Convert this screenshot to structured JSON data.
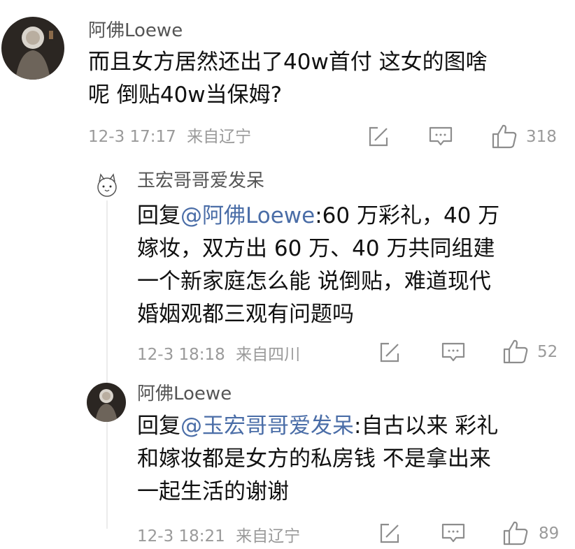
{
  "comments": [
    {
      "author": "阿佛Loewe",
      "text_lines": [
        "而且女方居然还出了40w首付 这女的图啥",
        "呢 倒贴40w当保姆?"
      ],
      "timestamp": "12-3 17:17",
      "location": "来自辽宁",
      "likes": "318"
    },
    {
      "author": "玉宏哥哥爱发呆",
      "reply_prefix": "回复",
      "reply_to": "@阿佛Loewe",
      "text_first": ":60 万彩礼，40 万",
      "text_lines": [
        "嫁妆，双方出 60 万、40 万共同组建",
        "一个新家庭怎么能 说倒贴，难道现代",
        "婚姻观都三观有问题吗"
      ],
      "timestamp": "12-3 18:18",
      "location": "来自四川",
      "likes": "52"
    },
    {
      "author": "阿佛Loewe",
      "reply_prefix": "回复",
      "reply_to": "@玉宏哥哥爱发呆",
      "text_first": ":自古以来 彩礼",
      "text_lines": [
        "和嫁妆都是女方的私房钱 不是拿出来",
        "一起生活的谢谢"
      ],
      "timestamp": "12-3 18:21",
      "location": "来自辽宁",
      "likes": "89"
    }
  ],
  "icons": [
    "share-icon",
    "comment-icon",
    "thumbs-up-icon"
  ]
}
